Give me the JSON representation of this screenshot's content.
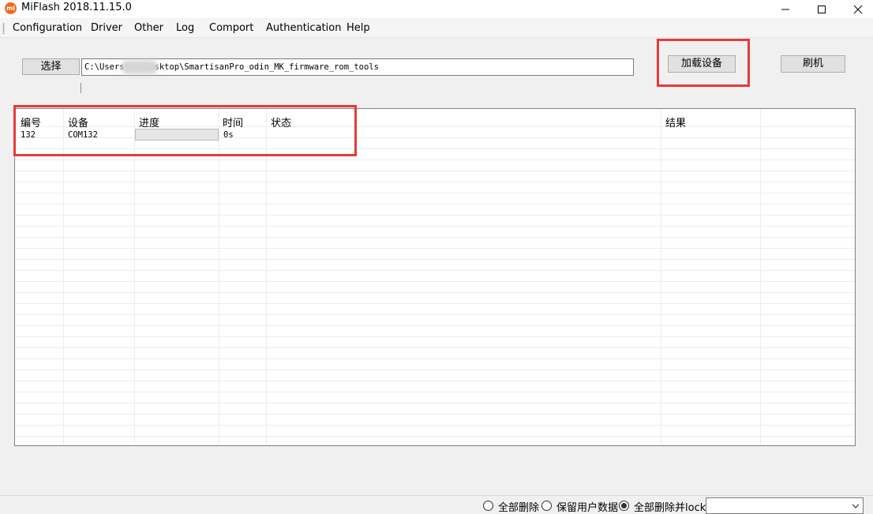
{
  "window": {
    "title": "MiFlash 2018.11.15.0",
    "icon_text": "mi",
    "brand_color": "#f06a1f"
  },
  "menu": {
    "items": [
      "Configuration",
      "Driver",
      "Other",
      "Log",
      "Comport",
      "Authentication",
      "Help"
    ]
  },
  "toolbar": {
    "select_label": "选择",
    "path_value": "C:\\Users\\      n\\Desktop\\SmartisanPro_odin_MK_firmware_rom_tools",
    "load_device_label": "加载设备",
    "flash_label": "刷机"
  },
  "highlight_color": "#e63a3a",
  "grid": {
    "columns": [
      "编号",
      "设备",
      "进度",
      "时间",
      "状态",
      "结果"
    ],
    "rows": [
      {
        "id": "132",
        "device": "COM132",
        "progress": 0,
        "time": "0s",
        "status": "",
        "result": ""
      }
    ],
    "progress_color": "#06b025"
  },
  "statusbar": {
    "options": [
      "全部删除",
      "保留用户数据",
      "全部删除并lock"
    ],
    "selected_index": 2,
    "combo_value": ""
  }
}
